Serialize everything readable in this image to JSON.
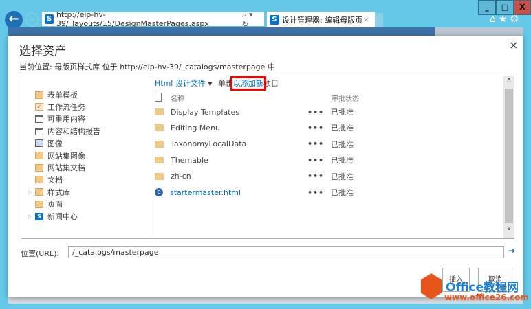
{
  "browser": {
    "url": "http://eip-hv-39/_layouts/15/DesignMasterPages.aspx",
    "tab_title": "设计管理器: 编辑母版页",
    "tab_close": "×",
    "window_buttons": [
      "_",
      "□",
      "X"
    ]
  },
  "dialog": {
    "title": "选择资产",
    "close": "×",
    "location_text": "当前位置: 母版页样式库 位于 http://eip-hv-39/_catalogs/masterpage 中",
    "tree": [
      {
        "label": "表单模板",
        "icon": "folder-doc-icon"
      },
      {
        "label": "工作流任务",
        "icon": "task-icon"
      },
      {
        "label": "可重用内容",
        "icon": "list-icon"
      },
      {
        "label": "内容和结构报告",
        "icon": "list-icon"
      },
      {
        "label": "图像",
        "icon": "image-icon"
      },
      {
        "label": "网站集图像",
        "icon": "folder-doc-icon"
      },
      {
        "label": "网站集文档",
        "icon": "folder-doc-icon"
      },
      {
        "label": "文档",
        "icon": "folder-doc-icon"
      },
      {
        "label": "样式库",
        "icon": "folder-doc-icon",
        "expandable": true
      },
      {
        "label": "页面",
        "icon": "folder-doc-icon"
      },
      {
        "label": "新闻中心",
        "icon": "sharepoint-icon",
        "expandable": true
      }
    ],
    "view_menu": "Html 设计文件",
    "add_prefix": "单击",
    "add_link": "以添加新",
    "add_suffix": "项目",
    "columns": {
      "name": "名称",
      "status": "审批状态"
    },
    "files": [
      {
        "name": "Display Templates",
        "type": "folder",
        "status": "已批准"
      },
      {
        "name": "Editing Menu",
        "type": "folder",
        "status": "已批准"
      },
      {
        "name": "TaxonomyLocalData",
        "type": "folder",
        "status": "已批准"
      },
      {
        "name": "Themable",
        "type": "folder",
        "status": "已批准"
      },
      {
        "name": "zh-cn",
        "type": "folder",
        "status": "已批准"
      },
      {
        "name": "startermaster.html",
        "type": "html",
        "status": "已批准"
      }
    ],
    "ellipsis": "•••",
    "url_label": "位置(URL):",
    "url_value": "/_catalogs/masterpage",
    "insert": "插入",
    "cancel": "取消"
  },
  "watermark": {
    "title": "Office教程网",
    "url": "www.office26.com"
  },
  "colors": {
    "accent": "#0072c6",
    "highlight": "#ff0000"
  }
}
